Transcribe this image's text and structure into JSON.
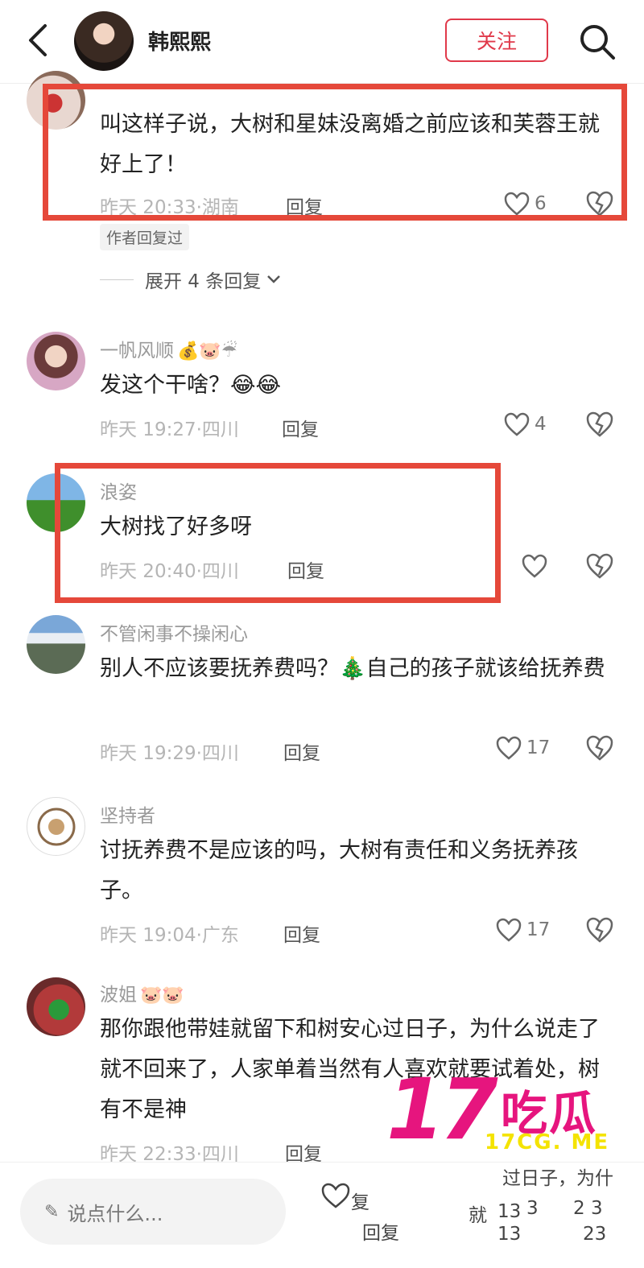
{
  "header": {
    "username": "韩熙熙",
    "follow_label": "关注"
  },
  "comments": [
    {
      "body": "叫这样子说，大树和星妹没离婚之前应该和芙蓉王就好上了！",
      "time": "昨天 20:33·湖南",
      "reply": "回复",
      "likes": "6",
      "tag": "作者回复过",
      "expand": "展开 4 条回复"
    },
    {
      "username": "一帆风顺",
      "emojis": "💰🐷☔",
      "body": "发这个干啥？😂😂",
      "time": "昨天 19:27·四川",
      "reply": "回复",
      "likes": "4"
    },
    {
      "username": "浪姿",
      "body": "大树找了好多呀",
      "time": "昨天 20:40·四川",
      "reply": "回复",
      "likes": ""
    },
    {
      "username": "不管闲事不操闲心",
      "body": "别人不应该要抚养费吗？🎄自己的孩子就该给抚养费",
      "time": "昨天 19:29·四川",
      "reply": "回复",
      "likes": "17"
    },
    {
      "username": "坚持者",
      "body": "讨抚养费不是应该的吗，大树有责任和义务抚养孩子。",
      "time": "昨天 19:04·广东",
      "reply": "回复",
      "likes": "17"
    },
    {
      "username": "波姐",
      "emojis": "🐷🐷",
      "body": "那你跟他带娃就留下和树安心过日子，为什么说走了就不回来了，人家单着当然有人喜欢就要试着处，树有不是神",
      "time": "昨天 22:33·四川",
      "reply": "回复"
    }
  ],
  "bottom": {
    "input_placeholder": "说点什么...",
    "ghost": [
      "复",
      "回复",
      "过日子，为什",
      "就",
      "13",
      "3",
      "2 3",
      "13",
      "23"
    ]
  },
  "watermark": {
    "number": "17",
    "text": "吃瓜",
    "site": "17CG. ME"
  },
  "colors": {
    "accent": "#e0394a",
    "highlight_box": "#e5483a",
    "watermark": "#e6157e",
    "watermark_site": "#f4e300"
  }
}
